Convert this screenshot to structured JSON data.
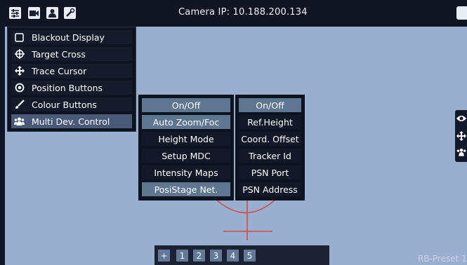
{
  "colors": {
    "background": "#9aaed0",
    "panel": "#0d1420",
    "highlight_button": "#5e7690",
    "selected_menu": "#485a78",
    "crosshair": "#d24a3f"
  },
  "topbar": {
    "icons": [
      "sliders-icon",
      "video-camera-icon",
      "user-icon",
      "wrench-icon"
    ],
    "camera_label": "Camera IP: 10.188.200.134"
  },
  "left_menu": {
    "items": [
      {
        "icon": "square-outline-icon",
        "label": "Blackout Display"
      },
      {
        "icon": "target-cross-icon",
        "label": "Target Cross"
      },
      {
        "icon": "move-arrows-icon",
        "label": "Trace Cursor"
      },
      {
        "icon": "radio-target-icon",
        "label": "Position Buttons"
      },
      {
        "icon": "paint-brush-icon",
        "label": "Colour Buttons"
      },
      {
        "icon": "users-group-icon",
        "label": "Multi Dev. Control",
        "active": true
      }
    ]
  },
  "mdc_menu": {
    "items": [
      {
        "label": "On/Off",
        "highlight": true
      },
      {
        "label": "Auto Zoom/Foc",
        "highlight": true
      },
      {
        "label": "Height Mode"
      },
      {
        "label": "Setup MDC"
      },
      {
        "label": "Intensity Maps"
      },
      {
        "label": "PosiStage Net.",
        "highlight": true
      }
    ]
  },
  "psn_menu": {
    "items": [
      {
        "label": "On/Off",
        "highlight": true
      },
      {
        "label": "Ref.Height"
      },
      {
        "label": "Coord. Offset"
      },
      {
        "label": "Tracker Id"
      },
      {
        "label": "PSN Port"
      },
      {
        "label": "PSN Address"
      }
    ]
  },
  "bottom_bar": {
    "add_label": "+",
    "pages": [
      "1",
      "2",
      "3",
      "4",
      "5"
    ]
  },
  "right_dock": {
    "icons": [
      "eye-icon",
      "move-arrows-icon",
      "users-group-icon"
    ]
  },
  "preset_label": "RB-Preset 1"
}
